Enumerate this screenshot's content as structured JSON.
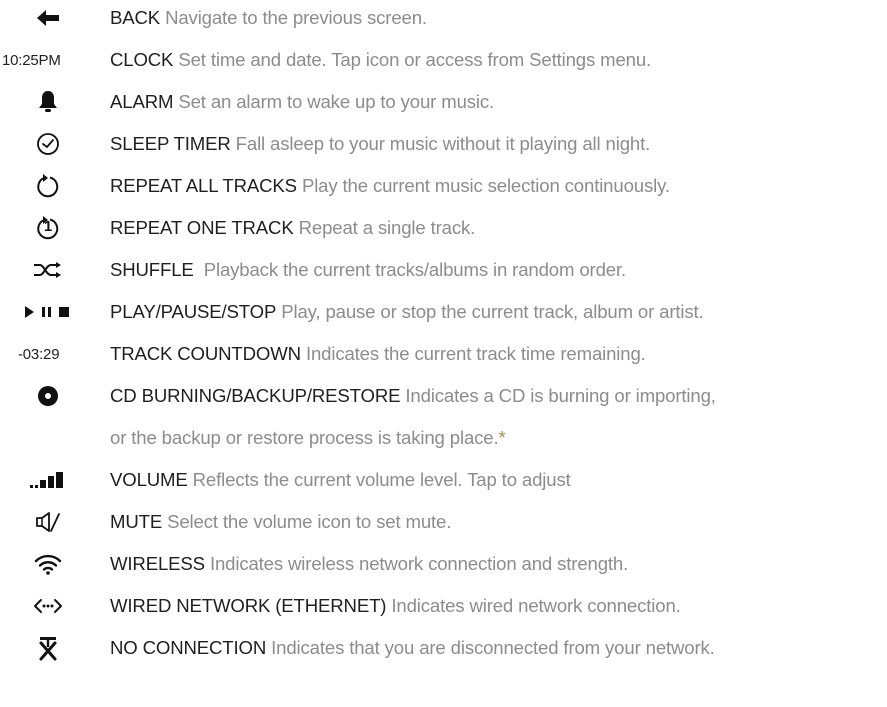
{
  "rows": [
    {
      "icon": "back-arrow-icon",
      "term": "BACK",
      "desc": "Navigate to the previous screen."
    },
    {
      "icon_text": "10:25PM",
      "term": "CLOCK",
      "desc": "Set time and date. Tap icon or access from Settings menu."
    },
    {
      "icon": "bell-icon",
      "term": "ALARM",
      "desc": "Set an alarm to wake up to your music."
    },
    {
      "icon": "clock-check-icon",
      "term": "SLEEP TIMER",
      "desc": "Fall asleep to your music without it playing all night."
    },
    {
      "icon": "repeat-all-icon",
      "term": "REPEAT ALL TRACKS",
      "desc": "Play the current music selection continuously."
    },
    {
      "icon": "repeat-one-icon",
      "icon_label": "1",
      "term": "REPEAT ONE TRACK",
      "desc": "Repeat a single track."
    },
    {
      "icon": "shuffle-icon",
      "term": "SHUFFLE",
      "desc": " Playback the current tracks/albums in random order."
    },
    {
      "icon": "play-pause-stop-icon",
      "term": "PLAY/PAUSE/STOP",
      "desc": "Play, pause or stop the current track, album or artist."
    },
    {
      "icon_text": "-03:29",
      "term": "TRACK COUNTDOWN",
      "desc": "Indicates the current track time remaining."
    },
    {
      "icon": "cd-disc-icon",
      "term": "CD BURNING/BACKUP/RESTORE",
      "desc": "Indicates a CD is burning or importing,",
      "desc_line2": "or the backup or restore process is taking place.",
      "footnote_mark": "*"
    },
    {
      "icon": "volume-bars-icon",
      "term": "VOLUME",
      "desc": "Reflects the current volume level. Tap to adjust"
    },
    {
      "icon": "mute-speaker-icon",
      "term": "MUTE",
      "desc": "Select the volume icon to set mute."
    },
    {
      "icon": "wifi-icon",
      "term": "WIRELESS",
      "desc": "Indicates wireless network connection and strength."
    },
    {
      "icon": "ethernet-arrows-icon",
      "term": "WIRED NETWORK (ETHERNET)",
      "desc": "Indicates wired network connection."
    },
    {
      "icon": "no-connection-icon",
      "term": "NO CONNECTION",
      "desc": "Indicates that you are disconnected from your network."
    }
  ],
  "colors": {
    "term": "#1f1f1f",
    "description": "#8c8c8c",
    "icon": "#111111",
    "footnote_mark": "#a08a5a"
  }
}
